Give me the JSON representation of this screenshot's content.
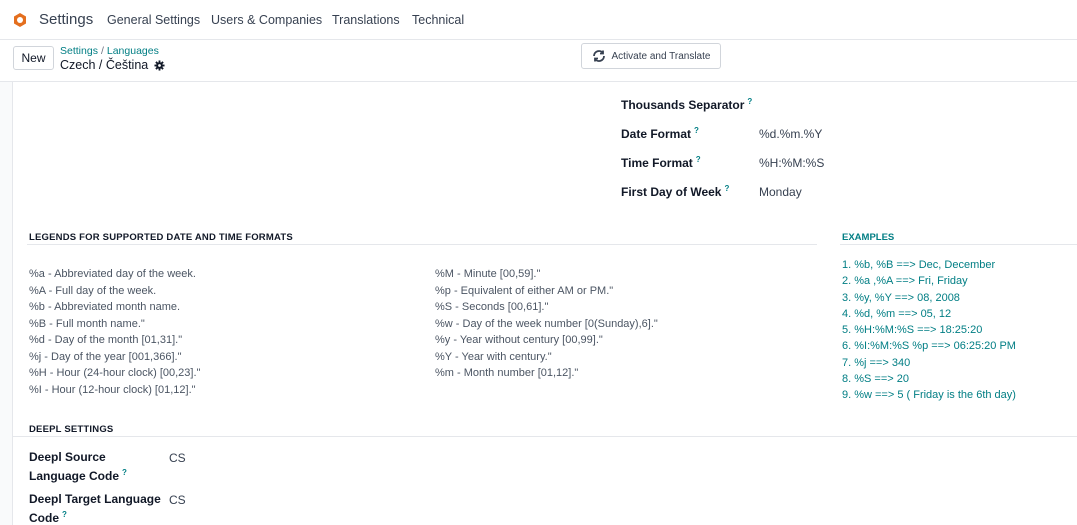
{
  "navbar": {
    "app_name": "Settings",
    "menu": [
      "General Settings",
      "Users & Companies",
      "Translations",
      "Technical"
    ]
  },
  "control": {
    "new_label": "New",
    "breadcrumb": [
      "Settings",
      "Languages"
    ],
    "record_name": "Czech / Čeština",
    "action_label": "Activate and Translate"
  },
  "fields": [
    {
      "label": "Thousands Separator",
      "value": ""
    },
    {
      "label": "Date Format",
      "value": "%d.%m.%Y"
    },
    {
      "label": "Time Format",
      "value": "%H:%M:%S"
    },
    {
      "label": "First Day of Week",
      "value": "Monday"
    }
  ],
  "help_mark": "?",
  "legends": {
    "title": "LEGENDS FOR SUPPORTED DATE AND TIME FORMATS",
    "col1": [
      "%a - Abbreviated day of the week.",
      "%A - Full day of the week.",
      "%b - Abbreviated month name.",
      "%B - Full month name.\"",
      "%d - Day of the month [01,31].\"",
      "%j - Day of the year [001,366].\"",
      "%H - Hour (24-hour clock) [00,23].\"",
      "%I - Hour (12-hour clock) [01,12].\""
    ],
    "col2": [
      "%M - Minute [00,59].\"",
      "%p - Equivalent of either AM or PM.\"",
      "%S - Seconds [00,61].\"",
      "%w - Day of the week number [0(Sunday),6].\"",
      "%y - Year without century [00,99].\"",
      "%Y - Year with century.\"",
      "%m - Month number [01,12].\""
    ]
  },
  "examples": {
    "title": "EXAMPLES",
    "items": [
      "1. %b, %B ==> Dec, December",
      "2. %a ,%A ==> Fri, Friday",
      "3. %y, %Y ==> 08, 2008",
      "4. %d, %m ==> 05, 12",
      "5. %H:%M:%S ==> 18:25:20",
      "6. %I:%M:%S %p ==> 06:25:20 PM",
      "7. %j ==> 340",
      "8. %S ==> 20",
      "9. %w ==> 5 ( Friday is the 6th day)"
    ]
  },
  "deepl": {
    "title": "DEEPL SETTINGS",
    "source_label_line1": "Deepl Source",
    "source_label_line2": "Language Code",
    "source_value": "CS",
    "target_label_line1": "Deepl Target Language",
    "target_label_line2": "Code",
    "target_value": "CS"
  },
  "colors": {
    "accent": "#017e84",
    "logo": "#e46f1e"
  },
  "icons": {
    "logo": "odoo-logo-icon",
    "gear": "gear-icon",
    "refresh": "refresh-icon"
  }
}
